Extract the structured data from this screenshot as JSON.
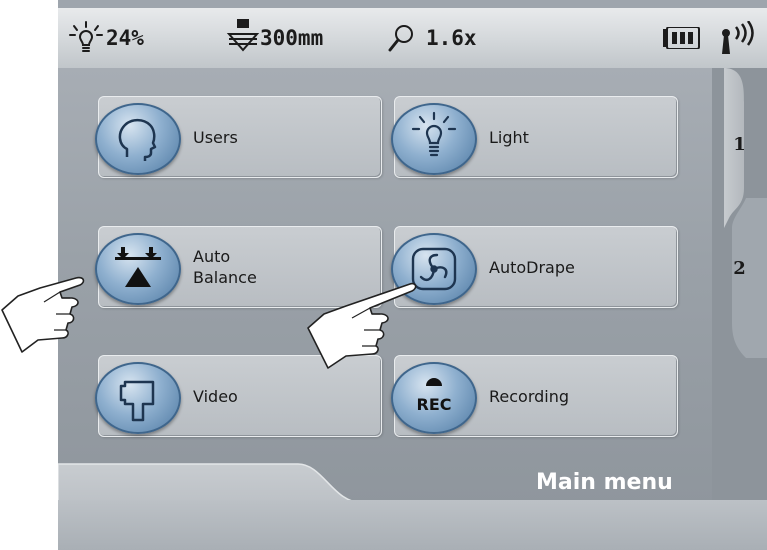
{
  "status": {
    "light": "24%",
    "distance": "300mm",
    "zoom": "1.6x",
    "battery_icon": "battery-icon",
    "signal_icon": "wireless-signal-icon"
  },
  "buttons": [
    {
      "label": "Users",
      "icon": "user-head-icon"
    },
    {
      "label": "Light",
      "icon": "light-bulb-icon"
    },
    {
      "label": "Auto\nBalance",
      "icon": "auto-balance-icon"
    },
    {
      "label": "AutoDrape",
      "icon": "fan-icon"
    },
    {
      "label": "Video",
      "icon": "video-camera-icon"
    },
    {
      "label": "Recording",
      "icon_text": "REC",
      "icon": "record-icon"
    }
  ],
  "tabs": [
    "1",
    "2"
  ],
  "title": "Main menu"
}
